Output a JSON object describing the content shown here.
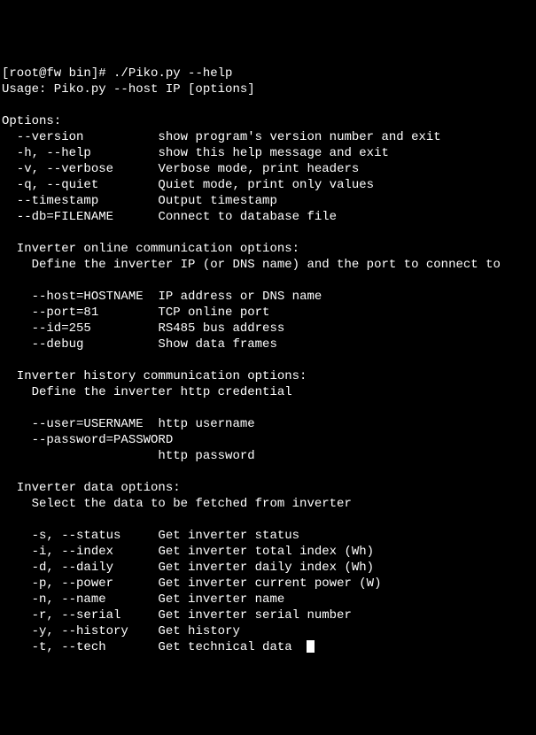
{
  "terminal": {
    "prompt": "[root@fw bin]# ",
    "command": "./Piko.py --help",
    "usage": "Usage: Piko.py --host IP [options]",
    "optionsHeader": "Options:",
    "options": [
      {
        "flag": "  --version",
        "desc": "          show program's version number and exit"
      },
      {
        "flag": "  -h, --help",
        "desc": "         show this help message and exit"
      },
      {
        "flag": "  -v, --verbose",
        "desc": "      Verbose mode, print headers"
      },
      {
        "flag": "  -q, --quiet",
        "desc": "        Quiet mode, print only values"
      },
      {
        "flag": "  --timestamp",
        "desc": "        Output timestamp"
      },
      {
        "flag": "  --db=FILENAME",
        "desc": "      Connect to database file"
      }
    ],
    "onlineHeader": "  Inverter online communication options:",
    "onlineDesc": "    Define the inverter IP (or DNS name) and the port to connect to",
    "onlineOptions": [
      {
        "flag": "    --host=HOSTNAME",
        "desc": "  IP address or DNS name"
      },
      {
        "flag": "    --port=81",
        "desc": "        TCP online port"
      },
      {
        "flag": "    --id=255",
        "desc": "         RS485 bus address"
      },
      {
        "flag": "    --debug",
        "desc": "          Show data frames"
      }
    ],
    "historyHeader": "  Inverter history communication options:",
    "historyDesc": "    Define the inverter http credential",
    "historyOptions": [
      {
        "flag": "    --user=USERNAME",
        "desc": "  http username"
      },
      {
        "flag": "    --password=PASSWORD",
        "desc": ""
      },
      {
        "flag": "",
        "desc": "                     http password"
      }
    ],
    "dataHeader": "  Inverter data options:",
    "dataDesc": "    Select the data to be fetched from inverter",
    "dataOptions": [
      {
        "flag": "    -s, --status",
        "desc": "     Get inverter status"
      },
      {
        "flag": "    -i, --index",
        "desc": "      Get inverter total index (Wh)"
      },
      {
        "flag": "    -d, --daily",
        "desc": "      Get inverter daily index (Wh)"
      },
      {
        "flag": "    -p, --power",
        "desc": "      Get inverter current power (W)"
      },
      {
        "flag": "    -n, --name",
        "desc": "       Get inverter name"
      },
      {
        "flag": "    -r, --serial",
        "desc": "     Get inverter serial number"
      },
      {
        "flag": "    -y, --history",
        "desc": "    Get history"
      },
      {
        "flag": "    -t, --tech",
        "desc": "       Get technical data"
      }
    ]
  }
}
